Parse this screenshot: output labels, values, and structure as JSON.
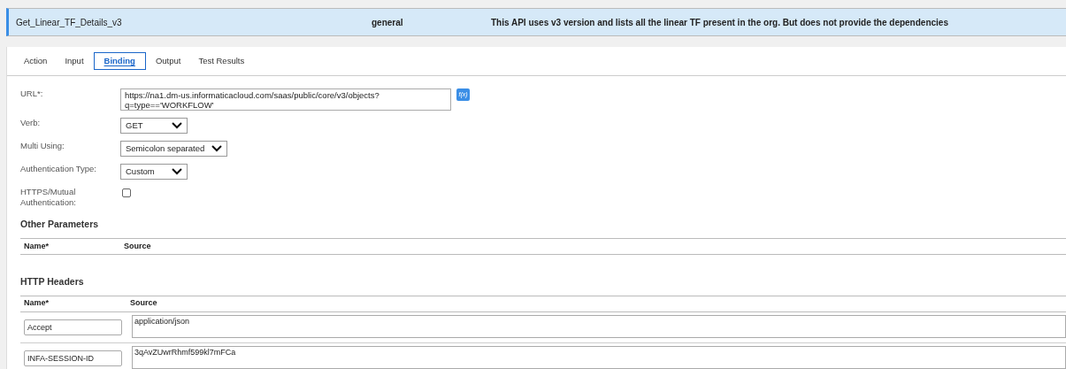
{
  "api_row": {
    "name": "Get_Linear_TF_Details_v3",
    "category": "general",
    "description": "This API uses v3 version and lists all the linear TF present in the org. But does not provide the dependencies",
    "selected": true
  },
  "tabs": [
    {
      "label": "Action",
      "selected": false
    },
    {
      "label": "Input",
      "selected": false
    },
    {
      "label": "Binding",
      "selected": true
    },
    {
      "label": "Output",
      "selected": false
    },
    {
      "label": "Test Results",
      "selected": false
    }
  ],
  "form": {
    "url_label": "URL*:",
    "url_value": "https://na1.dm-us.informaticacloud.com/saas/public/core/v3/objects?\nq=type=='WORKFLOW'",
    "fx_label": "f(x)",
    "fields": [
      {
        "kind": "select",
        "label": "Verb:",
        "value": "GET"
      },
      {
        "kind": "select",
        "label": "Multi Using:",
        "value": "Semicolon separated"
      },
      {
        "kind": "select",
        "label": "Authentication Type:",
        "value": "Custom"
      },
      {
        "kind": "checkbox",
        "label": "HTTPS/Mutual Authentication:",
        "checked": false
      }
    ]
  },
  "other_parameters": {
    "title": "Other Parameters",
    "columns": [
      "Name*",
      "Source"
    ]
  },
  "http_headers": {
    "title": "HTTP Headers",
    "columns": [
      "Name*",
      "Source"
    ],
    "rows": [
      {
        "name": "Accept",
        "source": "application/json"
      },
      {
        "name": "INFA-SESSION-ID",
        "source": "3qAvZUwrRhmf599kl7mFCa"
      }
    ]
  }
}
